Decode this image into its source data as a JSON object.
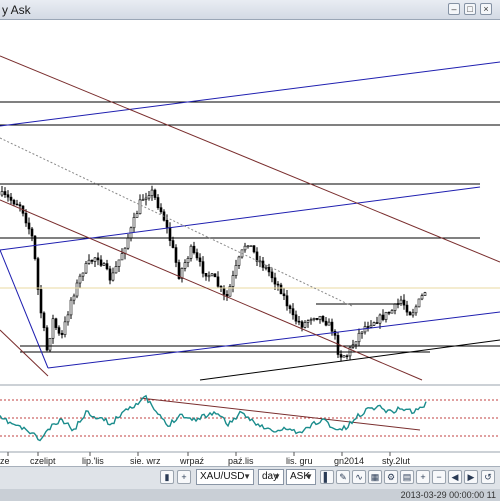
{
  "window": {
    "title": "y Ask"
  },
  "price_chart": {
    "instrument": "XAU/USD",
    "timeframe": "day",
    "side": "ASK",
    "type": "candlestick",
    "x_labels": [
      "ze",
      "czelipt",
      "lip.'lis",
      "sie. wrz",
      "wrpaź",
      "paź.lis",
      "lis. gru",
      "gn2014",
      "sty.2lut"
    ]
  },
  "toolbar": {
    "instrument_value": "XAU/USD",
    "period_value": "day",
    "side_value": "ASK",
    "zoom_in_label": "+",
    "zoom_out_label": "−",
    "prev_label": "◀",
    "next_label": "▶"
  },
  "status": {
    "datetime": "2013-03-29 00:00:00  11"
  },
  "colors": {
    "candle": "#000000",
    "trendline_blue": "#1f1fb0",
    "trendline_brown": "#7a2e2e",
    "indicator": "#1a8c8c",
    "indicator_band": "#c04040"
  }
}
